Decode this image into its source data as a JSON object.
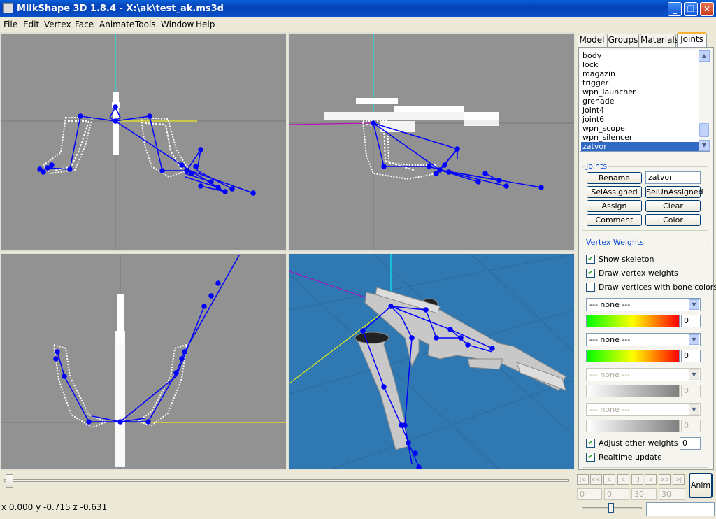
{
  "window": {
    "title": "MilkShape 3D 1.8.4 - X:\\ak\\test_ak.ms3d",
    "minimize": "_",
    "restore": "❐",
    "close": "✕"
  },
  "menu": [
    "File",
    "Edit",
    "Vertex",
    "Face",
    "Animate",
    "Tools",
    "Window",
    "Help"
  ],
  "tabs": [
    "Model",
    "Groups",
    "Materials",
    "Joints"
  ],
  "active_tab": "Joints",
  "joint_list": [
    "body",
    "lock",
    "magazin",
    "trigger",
    "wpn_launcher",
    "grenade",
    "joint4",
    "joint6",
    "wpn_scope",
    "wpn_silencer",
    "zatvor"
  ],
  "selected_joint": "zatvor",
  "joints_group": {
    "title": "Joints",
    "rename": "Rename",
    "name_value": "zatvor",
    "sel_assigned": "SelAssigned",
    "sel_unassigned": "SelUnAssigned",
    "assign": "Assign",
    "clear": "Clear",
    "comment": "Comment",
    "color": "Color"
  },
  "vertex_weights": {
    "title": "Vertex Weights",
    "show_skeleton": "Show skeleton",
    "draw_vertex_weights": "Draw vertex weights",
    "draw_bone_colors": "Draw vertices with bone colors",
    "none": "--- none ---",
    "zero": "0",
    "adjust_other": "Adjust other weights",
    "adjust_value": "0",
    "realtime": "Realtime update"
  },
  "checks": {
    "show_skeleton": true,
    "draw_vertex_weights": true,
    "draw_bone_colors": false,
    "adjust_other": true,
    "realtime": true
  },
  "player": {
    "buttons": [
      "|<",
      "<<",
      "<",
      "<",
      "[]",
      ">",
      ">>",
      ">|",
      ">|"
    ],
    "anim": "Anim",
    "frame": "0",
    "f1": "0",
    "f2": "30",
    "f3": "30"
  },
  "status": "x 0.000 y -0.715 z -0.631",
  "colors": {
    "viewport_bg": "#929292",
    "viewport_3d_bg": "#2f78b1",
    "skeleton": "#0000ff",
    "mesh": "#ffffff",
    "axis_cyan": "#00ffff",
    "axis_yellow": "#ffff00",
    "axis_magenta": "#c000c0"
  }
}
